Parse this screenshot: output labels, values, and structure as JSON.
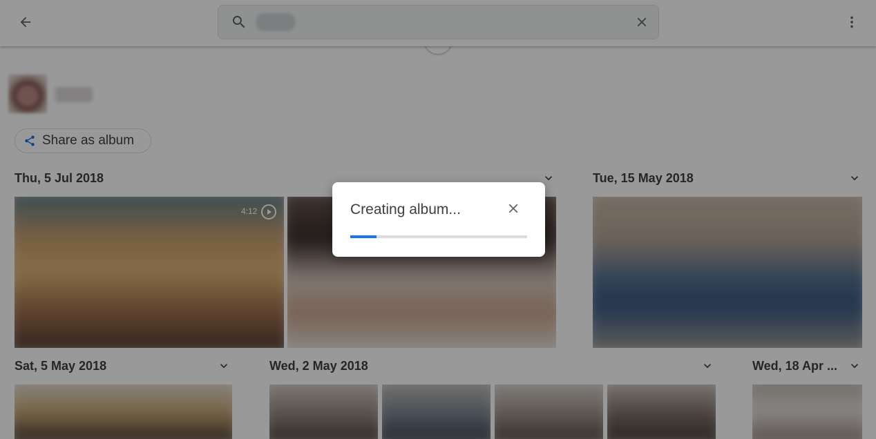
{
  "search": {
    "query": ""
  },
  "toolbar": {
    "back_icon": "arrow-left-icon",
    "search_icon": "search-icon",
    "clear_icon": "close-icon",
    "more_icon": "more-vert-icon"
  },
  "person": {
    "name": ""
  },
  "share_button": {
    "label": "Share as album",
    "icon": "share-icon",
    "color": "#1a73e8"
  },
  "date_groups": [
    {
      "label": "Thu, 5 Jul 2018",
      "video_duration": "4:12"
    },
    {
      "label": "Tue, 15 May 2018"
    },
    {
      "label": "Sat, 5 May 2018"
    },
    {
      "label": "Wed, 2 May 2018"
    },
    {
      "label": "Wed, 18 Apr ..."
    }
  ],
  "dialog": {
    "title": "Creating album...",
    "close_icon": "close-icon",
    "progress": 0.15,
    "accent": "#1a73e8"
  }
}
